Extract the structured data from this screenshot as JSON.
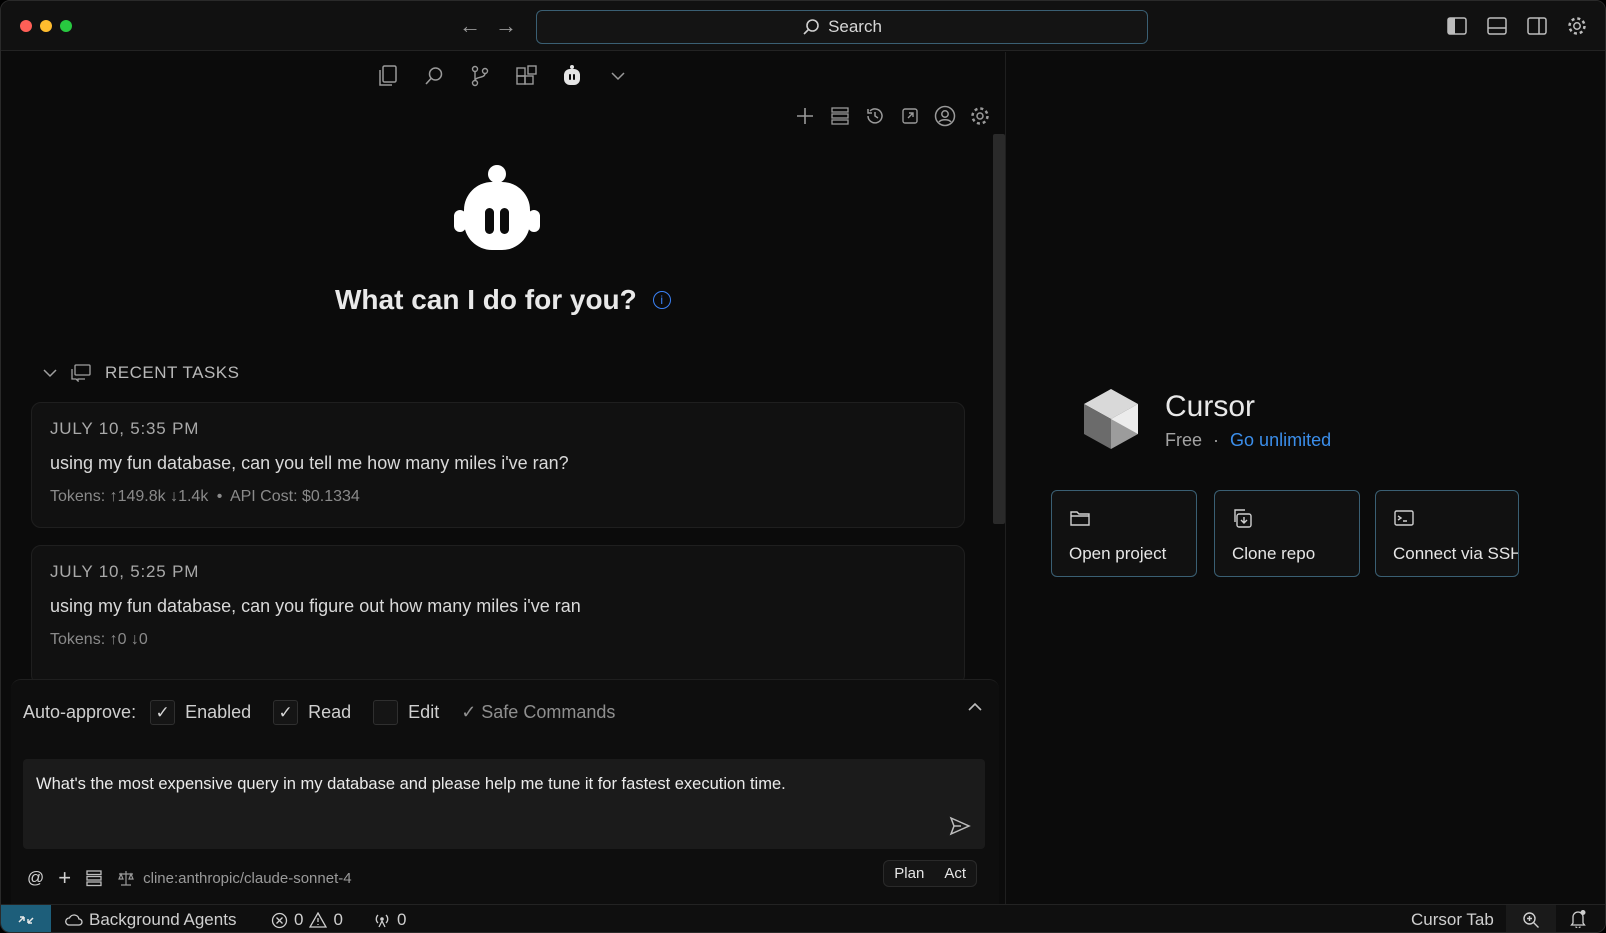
{
  "titlebar": {
    "traffic_colors": [
      "#ff5f57",
      "#febc2e",
      "#28c840"
    ],
    "search_label": "Search",
    "icons": [
      "sidebar-left-icon",
      "panel-bottom-icon",
      "sidebar-right-icon",
      "gear-icon"
    ]
  },
  "activity_tabs": [
    "explorer-icon",
    "search-icon",
    "source-control-icon",
    "extensions-icon",
    "cline-robot-icon",
    "chevron-down-icon"
  ],
  "cline_toolbar": [
    "plus-icon",
    "mcp-server-icon",
    "history-icon",
    "popout-icon",
    "account-icon",
    "settings-icon"
  ],
  "welcome": {
    "title": "What can I do for you?"
  },
  "recent_tasks": {
    "header": "RECENT TASKS",
    "items": [
      {
        "date": "JULY 10, 5:35 PM",
        "text": "using my fun database, can you tell me how many miles i've ran?",
        "tokens": "Tokens: ↑149.8k ↓1.4k",
        "cost": "API Cost: $0.1334"
      },
      {
        "date": "JULY 10, 5:25 PM",
        "text": "using my fun database, can you figure out how many miles i've ran",
        "tokens": "Tokens: ↑0 ↓0",
        "cost": ""
      }
    ]
  },
  "auto_approve": {
    "label": "Auto-approve:",
    "options": [
      {
        "label": "Enabled",
        "checked": true
      },
      {
        "label": "Read",
        "checked": true
      },
      {
        "label": "Edit",
        "checked": false
      }
    ],
    "safe_commands": "✓ Safe Commands"
  },
  "prompt": {
    "value": "What's the most expensive query in my database and please help me tune it for fastest execution time."
  },
  "bottom_bar": {
    "at": "@",
    "plus": "+",
    "model": "cline:anthropic/claude-sonnet-4",
    "plan": "Plan",
    "act": "Act"
  },
  "cursor_panel": {
    "title": "Cursor",
    "plan": "Free",
    "separator": "·",
    "upgrade": "Go unlimited",
    "actions": [
      {
        "label": "Open project",
        "icon": "folder-icon"
      },
      {
        "label": "Clone repo",
        "icon": "clone-icon"
      },
      {
        "label": "Connect via SSH",
        "icon": "terminal-icon"
      }
    ]
  },
  "statusbar": {
    "remote_icon": "remote-icon",
    "background_agents": "Background Agents",
    "errors": "0",
    "warnings": "0",
    "ports": "0",
    "cursor_tab": "Cursor Tab",
    "accent": "#1d5e7a"
  }
}
